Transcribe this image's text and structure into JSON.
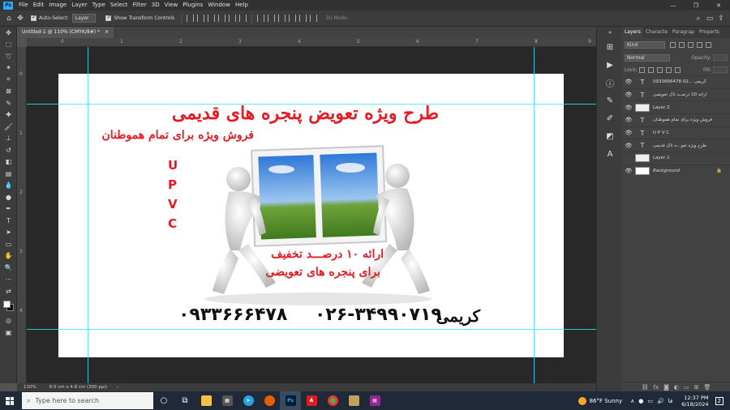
{
  "app": {
    "logo": "Ps"
  },
  "menubar": {
    "items": [
      "File",
      "Edit",
      "Image",
      "Layer",
      "Type",
      "Select",
      "Filter",
      "3D",
      "View",
      "Plugins",
      "Window",
      "Help"
    ]
  },
  "options": {
    "auto_select_label": "Auto-Select:",
    "auto_select_value": "Layer",
    "show_transform_label": "Show Transform Controls",
    "mode_3d": "3D Mode:"
  },
  "document": {
    "tab_title": "Untitled-1 @ 110% (CMYK/8#) *",
    "close": "×"
  },
  "rulers": {
    "top": [
      "0",
      "1",
      "2",
      "3",
      "4",
      "5",
      "6",
      "7",
      "8",
      "9"
    ],
    "left": [
      "0",
      "1",
      "2",
      "3",
      "4"
    ]
  },
  "card": {
    "title": "طرح ویژه تعویض پنجره های قدیمی",
    "subtitle": "فروش ویژه برای تمام هموطنان",
    "upvc": [
      "U",
      "P",
      "V",
      "C"
    ],
    "offer_line1": "ارائه ۱۰ درصـــد تخفیف",
    "offer_line2": "برای پنجره های تعویضی",
    "phone_mobile": "۰۹۳۳۶۶۶۴۷۸",
    "phone_office": "۰۲۶-۳۴۹۹۰۷۱۹",
    "name": "کریمی"
  },
  "status": {
    "zoom": "110%",
    "doc_size": "8.5 cm x 4.8 cm (300 ppi)",
    "arrow": "›"
  },
  "panels": {
    "tabs": [
      "Layers",
      "Characte",
      "Paragrap",
      "Properts"
    ],
    "kind_label": "Kind",
    "blend_mode": "Normal",
    "opacity_label": "Opacity:",
    "lock_label": "Lock:",
    "fill_label": "Fill:",
    "layers": [
      {
        "name": "کریمی     ...02     0933666478",
        "type": "text",
        "visible": true
      },
      {
        "name": "ارائه 10 درصــد تاک تعویضی",
        "type": "text",
        "visible": true
      },
      {
        "name": "Layer 2",
        "type": "image",
        "visible": true
      },
      {
        "name": "فروش ویژه برای تمام هموطنان",
        "type": "text",
        "visible": true
      },
      {
        "name": "U P V C",
        "type": "text",
        "visible": true
      },
      {
        "name": "طرح ویژه تعو...ه تاک قدیمی",
        "type": "text",
        "visible": true
      },
      {
        "name": "Layer 1",
        "type": "image",
        "visible": false
      },
      {
        "name": "Background",
        "type": "background",
        "visible": true
      }
    ]
  },
  "taskbar": {
    "search_placeholder": "Type here to search",
    "weather": "86°F  Sunny",
    "time": "12:37 PM",
    "date": "6/18/2024",
    "notifications": "2",
    "ps_label": "Ps"
  },
  "colors": {
    "accent_red": "#e41b23",
    "guide": "#2ee6f6",
    "ps_blue": "#31a8ff"
  }
}
